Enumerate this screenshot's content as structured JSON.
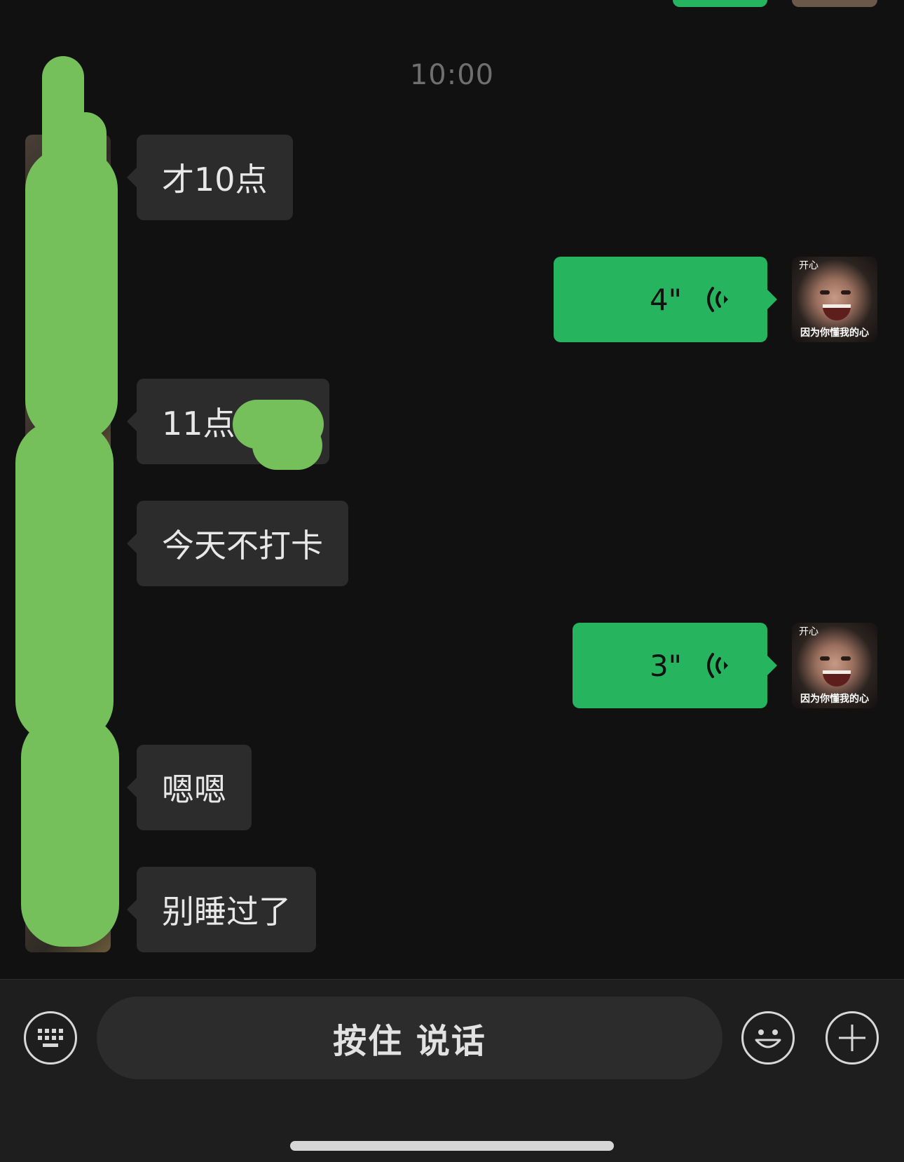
{
  "colors": {
    "background": "#111111",
    "incoming_bubble": "#2c2c2c",
    "outgoing_bubble": "#27b45f",
    "input_bar": "#1e1e1e",
    "timestamp_text": "#6f6f6f",
    "redaction_scribble": "#75c05a"
  },
  "chat": {
    "timestamp": "10:00",
    "messages": [
      {
        "side": "left",
        "type": "text",
        "text": "才10点"
      },
      {
        "side": "right",
        "type": "voice",
        "duration": "4\""
      },
      {
        "side": "left",
        "type": "text",
        "text": "11点"
      },
      {
        "side": "left",
        "type": "text",
        "text": "今天不打卡"
      },
      {
        "side": "right",
        "type": "voice",
        "duration": "3\""
      },
      {
        "side": "left",
        "type": "text",
        "text": "嗯嗯"
      },
      {
        "side": "left",
        "type": "text",
        "text": "别睡过了"
      }
    ],
    "my_avatar": {
      "caption_top": "开心",
      "caption_bottom": "因为你懂我的心"
    }
  },
  "input_bar": {
    "keyboard_icon": "keyboard-icon",
    "hold_to_talk_label": "按住 说话",
    "emoji_icon": "emoji-icon",
    "plus_icon": "plus-icon"
  }
}
